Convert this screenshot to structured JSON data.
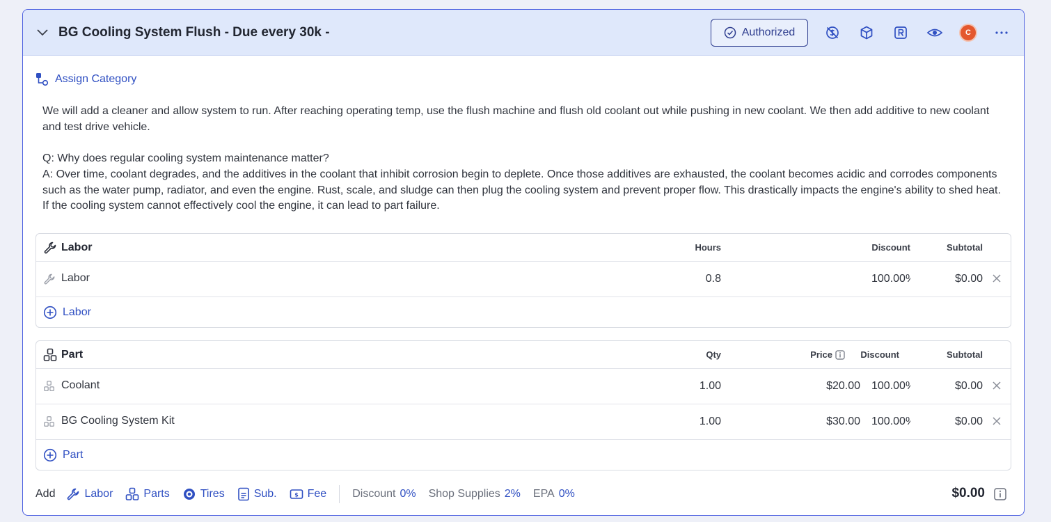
{
  "header": {
    "title": "BG Cooling System Flush - Due every 30k -",
    "authorized_label": "Authorized",
    "avatar_initial": "C"
  },
  "assign_category": "Assign Category",
  "description": [
    "We will add a cleaner and allow system to run.  After reaching operating temp, use the flush machine and flush old coolant out while pushing in new coolant.  We then add additive to new coolant and test drive vehicle.",
    "Q: Why does regular cooling system maintenance matter?\nA: Over time, coolant degrades, and the additives in the coolant that inhibit corrosion begin to deplete. Once those additives are exhausted, the coolant becomes acidic and corrodes components such as the water pump, radiator, and even the engine. Rust, scale, and sludge can then plug the cooling system and prevent proper flow. This drastically impacts the engine's ability to shed heat. If the cooling system cannot effectively cool the engine, it can lead to part failure."
  ],
  "labor": {
    "title": "Labor",
    "columns": {
      "hours": "Hours",
      "discount": "Discount",
      "subtotal": "Subtotal"
    },
    "rows": [
      {
        "name": "Labor",
        "hours": "0.8",
        "discount": "100.00%",
        "subtotal": "$0.00"
      }
    ],
    "add_label": "Labor"
  },
  "parts": {
    "title": "Part",
    "columns": {
      "qty": "Qty",
      "price": "Price",
      "discount": "Discount",
      "subtotal": "Subtotal"
    },
    "rows": [
      {
        "name": "Coolant",
        "qty": "1.00",
        "price": "$20.00",
        "discount": "100.00%",
        "subtotal": "$0.00"
      },
      {
        "name": "BG Cooling System Kit",
        "qty": "1.00",
        "price": "$30.00",
        "discount": "100.00%",
        "subtotal": "$0.00"
      }
    ],
    "add_label": "Part"
  },
  "footer": {
    "add_label": "Add",
    "links": {
      "labor": "Labor",
      "parts": "Parts",
      "tires": "Tires",
      "sub": "Sub.",
      "fee": "Fee"
    },
    "discount_label": "Discount",
    "discount_value": "0%",
    "shop_supplies_label": "Shop Supplies",
    "shop_supplies_value": "2%",
    "epa_label": "EPA",
    "epa_value": "0%",
    "total": "$0.00"
  },
  "colors": {
    "accent": "#2f4fc2",
    "header_bg": "#dfe8fb",
    "border": "#4a5ee0",
    "avatar": "#e4572e"
  }
}
